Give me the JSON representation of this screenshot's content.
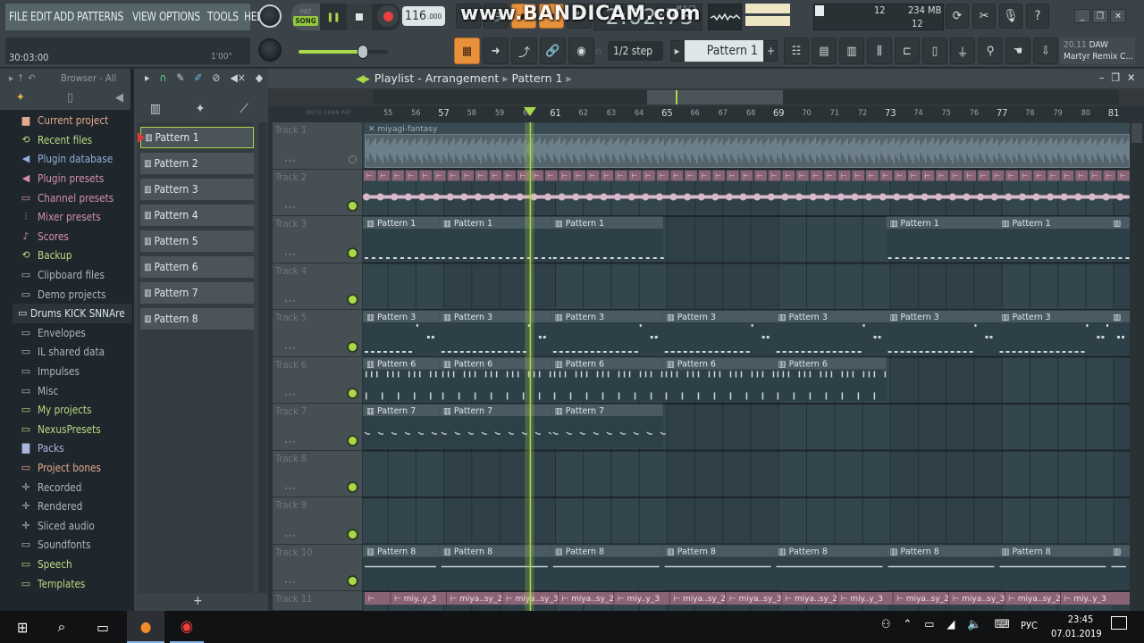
{
  "app": {
    "menu": [
      "FILE",
      "EDIT",
      "ADD",
      "PATTERNS",
      "VIEW",
      "OPTIONS",
      "TOOLS",
      "HELP"
    ],
    "hint_time": "30:03:00",
    "hint_duration": "1'00\"",
    "transport": {
      "pat_label": "PAT",
      "song_label": "SONG",
      "mode": "SONG",
      "play_state": "playing",
      "tempo": "116",
      "tempo_decimals": ".000"
    },
    "song_time": "2:02:73",
    "time_format": "M:S:CS",
    "watermark": "www.BANDICAM.com",
    "cpu": "12",
    "memory": "234 MB",
    "polyphony": "12",
    "step": "1/2 step",
    "pattern_selected": "Pattern 1",
    "news": {
      "line1_dim": "20.11",
      "line1": "DAW",
      "line2": "Martyr Remix C..."
    },
    "master_pitch_fraction": 0.72
  },
  "browser": {
    "title": "Browser - All",
    "items": [
      {
        "label": "Current project",
        "icon": "project-icon",
        "glyph": "▆",
        "color": "#e6a88f"
      },
      {
        "label": "Recent files",
        "icon": "recent-folder-icon",
        "glyph": "⟲",
        "color": "#b9d983"
      },
      {
        "label": "Plugin database",
        "icon": "plug-icon",
        "glyph": "◀",
        "color": "#8fb0dc"
      },
      {
        "label": "Plugin presets",
        "icon": "plug-icon",
        "glyph": "◀",
        "color": "#d48fb0"
      },
      {
        "label": "Channel presets",
        "icon": "channel-icon",
        "glyph": "▭",
        "color": "#d48fb0"
      },
      {
        "label": "Mixer presets",
        "icon": "mixer-icon",
        "glyph": "⫶",
        "color": "#d48fb0"
      },
      {
        "label": "Scores",
        "icon": "note-icon",
        "glyph": "♪",
        "color": "#d48fb0"
      },
      {
        "label": "Backup",
        "icon": "recent-folder-icon",
        "glyph": "⟲",
        "color": "#b9d983"
      },
      {
        "label": "Clipboard files",
        "icon": "folder-icon",
        "glyph": "▭",
        "color": "#a9b7bb"
      },
      {
        "label": "Demo projects",
        "icon": "folder-icon",
        "glyph": "▭",
        "color": "#a9b7bb"
      },
      {
        "label": "Drums KICK SNNAre",
        "icon": "folder-icon",
        "glyph": "▭",
        "color": "#d9e6e6",
        "selected": true
      },
      {
        "label": "Envelopes",
        "icon": "folder-icon",
        "glyph": "▭",
        "color": "#a9b7bb"
      },
      {
        "label": "IL shared data",
        "icon": "folder-icon",
        "glyph": "▭",
        "color": "#a9b7bb"
      },
      {
        "label": "Impulses",
        "icon": "folder-icon",
        "glyph": "▭",
        "color": "#a9b7bb"
      },
      {
        "label": "Misc",
        "icon": "folder-icon",
        "glyph": "▭",
        "color": "#a9b7bb"
      },
      {
        "label": "My projects",
        "icon": "folder-icon",
        "glyph": "▭",
        "color": "#b9d983"
      },
      {
        "label": "NexusPresets",
        "icon": "folder-icon",
        "glyph": "▭",
        "color": "#b9d983"
      },
      {
        "label": "Packs",
        "icon": "packs-icon",
        "glyph": "▇",
        "color": "#a9b7e0"
      },
      {
        "label": "Project bones",
        "icon": "folder-icon",
        "glyph": "▭",
        "color": "#e6a88f"
      },
      {
        "label": "Recorded",
        "icon": "audio-icon",
        "glyph": "✛",
        "color": "#a9b7bb"
      },
      {
        "label": "Rendered",
        "icon": "audio-icon",
        "glyph": "✛",
        "color": "#a9b7bb"
      },
      {
        "label": "Sliced audio",
        "icon": "audio-icon",
        "glyph": "✛",
        "color": "#a9b7bb"
      },
      {
        "label": "Soundfonts",
        "icon": "folder-icon",
        "glyph": "▭",
        "color": "#a9b7bb"
      },
      {
        "label": "Speech",
        "icon": "folder-icon",
        "glyph": "▭",
        "color": "#b9d983"
      },
      {
        "label": "Templates",
        "icon": "folder-icon",
        "glyph": "▭",
        "color": "#b9d983"
      }
    ]
  },
  "patterns": [
    "Pattern 1",
    "Pattern 2",
    "Pattern 3",
    "Pattern 4",
    "Pattern 5",
    "Pattern 6",
    "Pattern 7",
    "Pattern 8"
  ],
  "playlist": {
    "title": "Playlist - Arrangement",
    "crumb": "Pattern 1",
    "ruler_modes": "NOTE  CHAN  PAT",
    "bar_start": 55,
    "bar_end": 81,
    "playhead_bar": 60.1,
    "tracks": [
      {
        "name": "Track 1",
        "led": "off"
      },
      {
        "name": "Track 2",
        "led": "on"
      },
      {
        "name": "Track 3",
        "led": "on"
      },
      {
        "name": "Track 4",
        "led": "on"
      },
      {
        "name": "Track 5",
        "led": "on"
      },
      {
        "name": "Track 6",
        "led": "on"
      },
      {
        "name": "Track 7",
        "led": "on"
      },
      {
        "name": "Track 8",
        "led": "on"
      },
      {
        "name": "Track 9",
        "led": "on"
      },
      {
        "name": "Track 10",
        "led": "on"
      },
      {
        "name": "Track 11",
        "led": "on"
      }
    ],
    "audio_clip": {
      "track": 1,
      "label": "miyagi-fantasy"
    },
    "clips": [
      {
        "track": 3,
        "label": "Pattern 1",
        "starts": [
          54.1,
          56.85,
          60.85,
          72.85,
          76.85,
          80.85
        ]
      },
      {
        "track": 5,
        "label": "Pattern 3",
        "starts": [
          54.1,
          56.85,
          60.85,
          64.85,
          68.85,
          72.85,
          76.85,
          80.85
        ]
      },
      {
        "track": 6,
        "label": "Pattern 6",
        "starts": [
          54.1,
          56.85,
          60.85,
          64.85,
          68.85
        ]
      },
      {
        "track": 7,
        "label": "Pattern 7",
        "starts": [
          54.1,
          56.85,
          60.85
        ]
      },
      {
        "track": 10,
        "label": "Pattern 8",
        "starts": [
          54.1,
          56.85,
          60.85,
          64.85,
          68.85,
          72.85,
          76.85,
          80.85
        ]
      }
    ],
    "track11_clips": [
      "miy..y_3",
      "miya..sy_2",
      "miya..sy_3",
      "miya..sy_2",
      "miy..y_3",
      "miya..sy_2",
      "miya..sy_3",
      "miya..sy_2",
      "miy..y_3",
      "miya..sy_2",
      "miya..sy_3",
      "miya..sy_2",
      "miy..y_3"
    ]
  },
  "taskbar": {
    "language": "РУС",
    "time": "23:45",
    "date": "07.01.2019"
  }
}
